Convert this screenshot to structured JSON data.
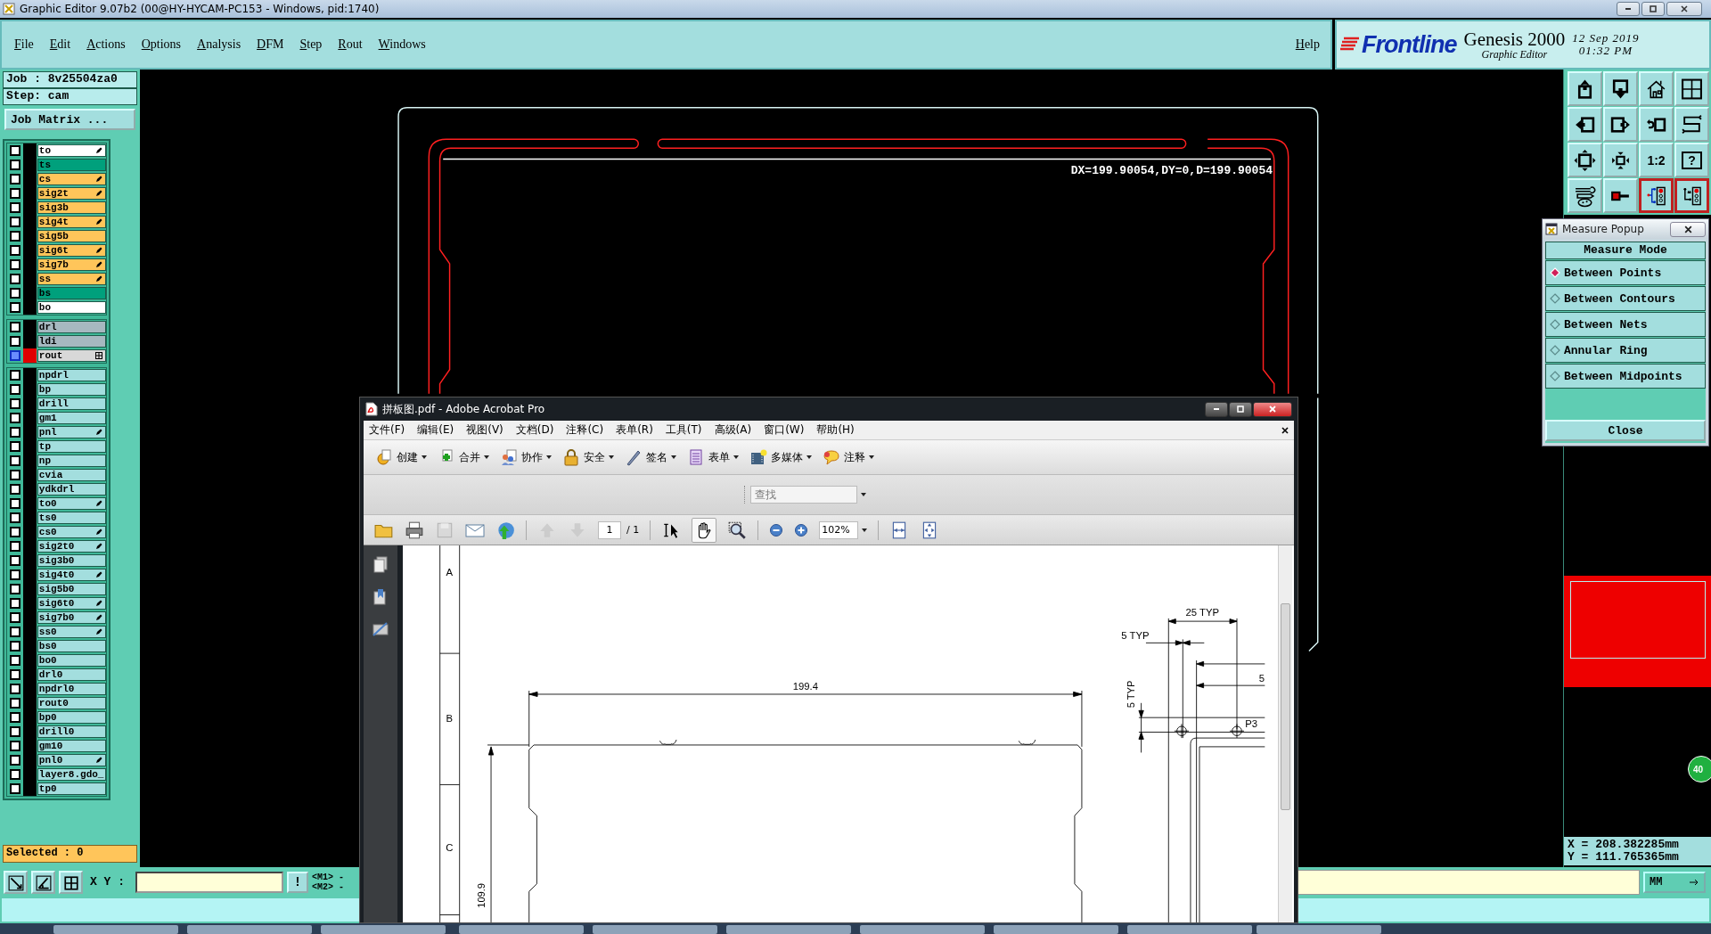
{
  "title_bar": {
    "title": "Graphic Editor 9.07b2 (00@HY-HYCAM-PC153 - Windows, pid:1740)"
  },
  "menu_bar": {
    "items": [
      "File",
      "Edit",
      "Actions",
      "Options",
      "Analysis",
      "DFM",
      "Step",
      "Rout",
      "Windows"
    ],
    "help": "Help"
  },
  "brand": {
    "logo": "Frontline",
    "product": "Genesis 2000",
    "subtitle": "Graphic Editor",
    "date": "12 Sep 2019",
    "time": "01:32 PM"
  },
  "job_panel": {
    "job": "Job : 8v25504za0",
    "step": "Step: cam",
    "matrix_button": "Job Matrix ...",
    "layer_groups": [
      {
        "layers": [
          {
            "name": "to",
            "color": "#ffffff",
            "affected": false,
            "work": false,
            "edit_flag": true
          },
          {
            "name": "ts",
            "color": "#00a07c",
            "affected": false,
            "work": false
          },
          {
            "name": "cs",
            "color": "#ffc55a",
            "affected": false,
            "work": false,
            "edit_flag": true
          },
          {
            "name": "sig2t",
            "color": "#ffc55a",
            "affected": false,
            "work": false,
            "edit_flag": true
          },
          {
            "name": "sig3b",
            "color": "#ffc55a",
            "affected": false,
            "work": false
          },
          {
            "name": "sig4t",
            "color": "#ffc55a",
            "affected": false,
            "work": false,
            "edit_flag": true
          },
          {
            "name": "sig5b",
            "color": "#ffc55a",
            "affected": false,
            "work": false
          },
          {
            "name": "sig6t",
            "color": "#ffc55a",
            "affected": false,
            "work": false,
            "edit_flag": true
          },
          {
            "name": "sig7b",
            "color": "#ffc55a",
            "affected": false,
            "work": false,
            "edit_flag": true
          },
          {
            "name": "ss",
            "color": "#ffc55a",
            "affected": false,
            "work": false,
            "edit_flag": true
          },
          {
            "name": "bs",
            "color": "#00a07c",
            "affected": false,
            "work": false
          },
          {
            "name": "bo",
            "color": "#ffffff",
            "affected": false,
            "work": false
          }
        ]
      },
      {
        "layers": [
          {
            "name": "drl",
            "color": "#a6b8c0",
            "affected": false,
            "work": false
          },
          {
            "name": "ldi",
            "color": "#a6b8c0",
            "affected": false,
            "work": false
          },
          {
            "name": "rout",
            "color": "#d8d8d8",
            "affected": true,
            "work": true,
            "board_flag": true
          }
        ]
      },
      {
        "layers": [
          {
            "name": "npdrl",
            "color": "#a3dede",
            "affected": false,
            "work": false
          },
          {
            "name": "bp",
            "color": "#a3dede",
            "affected": false,
            "work": false
          },
          {
            "name": "drill",
            "color": "#a3dede",
            "affected": false,
            "work": false
          },
          {
            "name": "gm1",
            "color": "#a3dede",
            "affected": false,
            "work": false
          },
          {
            "name": "pnl",
            "color": "#a3dede",
            "affected": false,
            "work": false,
            "edit_flag": true
          },
          {
            "name": "tp",
            "color": "#a3dede",
            "affected": false,
            "work": false
          },
          {
            "name": "np",
            "color": "#a3dede",
            "affected": false,
            "work": false
          },
          {
            "name": "cvia",
            "color": "#a3dede",
            "affected": false,
            "work": false
          },
          {
            "name": "ydkdrl",
            "color": "#a3dede",
            "affected": false,
            "work": false
          },
          {
            "name": "to0",
            "color": "#a3dede",
            "affected": false,
            "work": false,
            "edit_flag": true
          },
          {
            "name": "ts0",
            "color": "#a3dede",
            "affected": false,
            "work": false
          },
          {
            "name": "cs0",
            "color": "#a3dede",
            "affected": false,
            "work": false,
            "edit_flag": true
          },
          {
            "name": "sig2t0",
            "color": "#a3dede",
            "affected": false,
            "work": false,
            "edit_flag": true
          },
          {
            "name": "sig3b0",
            "color": "#a3dede",
            "affected": false,
            "work": false
          },
          {
            "name": "sig4t0",
            "color": "#a3dede",
            "affected": false,
            "work": false,
            "edit_flag": true
          },
          {
            "name": "sig5b0",
            "color": "#a3dede",
            "affected": false,
            "work": false
          },
          {
            "name": "sig6t0",
            "color": "#a3dede",
            "affected": false,
            "work": false,
            "edit_flag": true
          },
          {
            "name": "sig7b0",
            "color": "#a3dede",
            "affected": false,
            "work": false,
            "edit_flag": true
          },
          {
            "name": "ss0",
            "color": "#a3dede",
            "affected": false,
            "work": false,
            "edit_flag": true
          },
          {
            "name": "bs0",
            "color": "#a3dede",
            "affected": false,
            "work": false
          },
          {
            "name": "bo0",
            "color": "#a3dede",
            "affected": false,
            "work": false
          },
          {
            "name": "drl0",
            "color": "#a3dede",
            "affected": false,
            "work": false
          },
          {
            "name": "npdrl0",
            "color": "#a3dede",
            "affected": false,
            "work": false
          },
          {
            "name": "rout0",
            "color": "#a3dede",
            "affected": false,
            "work": false
          },
          {
            "name": "bp0",
            "color": "#a3dede",
            "affected": false,
            "work": false
          },
          {
            "name": "drill0",
            "color": "#a3dede",
            "affected": false,
            "work": false
          },
          {
            "name": "gm10",
            "color": "#a3dede",
            "affected": false,
            "work": false
          },
          {
            "name": "pnl0",
            "color": "#a3dede",
            "affected": false,
            "work": false,
            "edit_flag": true
          },
          {
            "name": "layer8.gdo_",
            "color": "#a3dede",
            "affected": false,
            "work": false
          },
          {
            "name": "tp0",
            "color": "#a3dede",
            "affected": false,
            "work": false
          }
        ]
      }
    ],
    "selected": "Selected : 0"
  },
  "canvas": {
    "measure_readout": "DX=199.90054,DY=0,D=199.90054"
  },
  "view_buttons": [
    {
      "kind": "box-up"
    },
    {
      "kind": "box-down"
    },
    {
      "kind": "house"
    },
    {
      "kind": "window-grid"
    },
    {
      "kind": "box-left"
    },
    {
      "kind": "box-right"
    },
    {
      "kind": "undo-box"
    },
    {
      "kind": "s-path"
    },
    {
      "kind": "expand"
    },
    {
      "kind": "shrink"
    },
    {
      "kind": "ratio",
      "label": "1:2"
    },
    {
      "kind": "help",
      "label": "?"
    },
    {
      "kind": "tools"
    },
    {
      "kind": "probe"
    },
    {
      "kind": "circuit"
    },
    {
      "kind": "circuit-alt"
    }
  ],
  "measure_popup": {
    "title": "Measure Popup",
    "heading": "Measure Mode",
    "modes": [
      {
        "label": "Between Points",
        "selected": true
      },
      {
        "label": "Between Contours",
        "selected": false
      },
      {
        "label": "Between Nets",
        "selected": false
      },
      {
        "label": "Annular Ring",
        "selected": false
      },
      {
        "label": "Between Midpoints",
        "selected": false
      }
    ],
    "close": "Close"
  },
  "edge_badge": "40",
  "cursor_readout": {
    "x": "X = 208.382285mm",
    "y": "Y = 111.765365mm"
  },
  "command_bar": {
    "xy_label": "X Y :",
    "bang": "!",
    "m1": "<M1> -",
    "m2": "<M2> -",
    "units": "MM"
  },
  "acrobat": {
    "title": "拼板图.pdf - Adobe Acrobat Pro",
    "menu": [
      "文件(F)",
      "编辑(E)",
      "视图(V)",
      "文档(D)",
      "注释(C)",
      "表单(R)",
      "工具(T)",
      "高级(A)",
      "窗口(W)",
      "帮助(H)"
    ],
    "tools": [
      {
        "label": "创建",
        "kind": "create"
      },
      {
        "label": "合并",
        "kind": "combine"
      },
      {
        "label": "协作",
        "kind": "collaborate"
      },
      {
        "label": "安全",
        "kind": "secure"
      },
      {
        "label": "签名",
        "kind": "sign"
      },
      {
        "label": "表单",
        "kind": "forms"
      },
      {
        "label": "多媒体",
        "kind": "multimedia"
      },
      {
        "label": "注释",
        "kind": "comment"
      }
    ],
    "search_placeholder": "查找",
    "page": "1",
    "page_count": "/ 1",
    "zoom": "102%",
    "page_drawing": {
      "rows": [
        "A",
        "B",
        "C"
      ],
      "labels": [
        "199.4",
        "109.9",
        "25 TYP",
        "5 TYP",
        "5 TYP",
        "5",
        "P3"
      ]
    }
  }
}
